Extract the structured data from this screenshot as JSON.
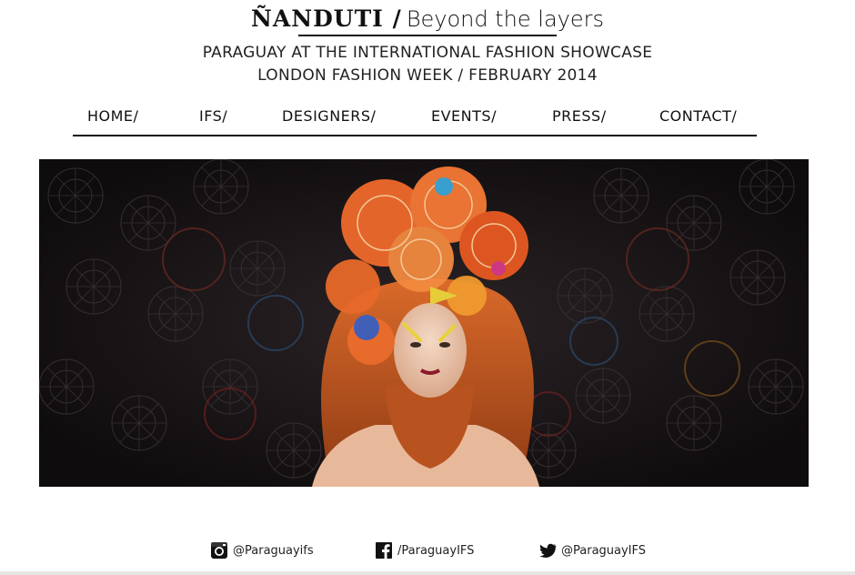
{
  "brand": {
    "main": "ÑANDUTI /",
    "sub": "Beyond the layers"
  },
  "tagline": {
    "line1": "PARAGUAY AT THE INTERNATIONAL FASHION SHOWCASE",
    "line2": "LONDON FASHION WEEK / FEBRUARY 2014"
  },
  "nav": {
    "items": [
      {
        "label": "HOME/"
      },
      {
        "label": "IFS/"
      },
      {
        "label": "DESIGNERS/"
      },
      {
        "label": "EVENTS/"
      },
      {
        "label": "PRESS/"
      },
      {
        "label": "CONTACT/"
      }
    ]
  },
  "hero": {
    "icon": "hero-photo-model-with-flower-headpiece",
    "colors": {
      "background": "#161214",
      "hair": "#c2561f",
      "headpiece": "#f06a2c"
    }
  },
  "social": {
    "instagram": {
      "icon": "instagram-icon",
      "label": "@Paraguayifs"
    },
    "facebook": {
      "icon": "facebook-icon",
      "label": "/ParaguayIFS"
    },
    "twitter": {
      "icon": "twitter-icon",
      "label": "@ParaguayIFS"
    }
  }
}
